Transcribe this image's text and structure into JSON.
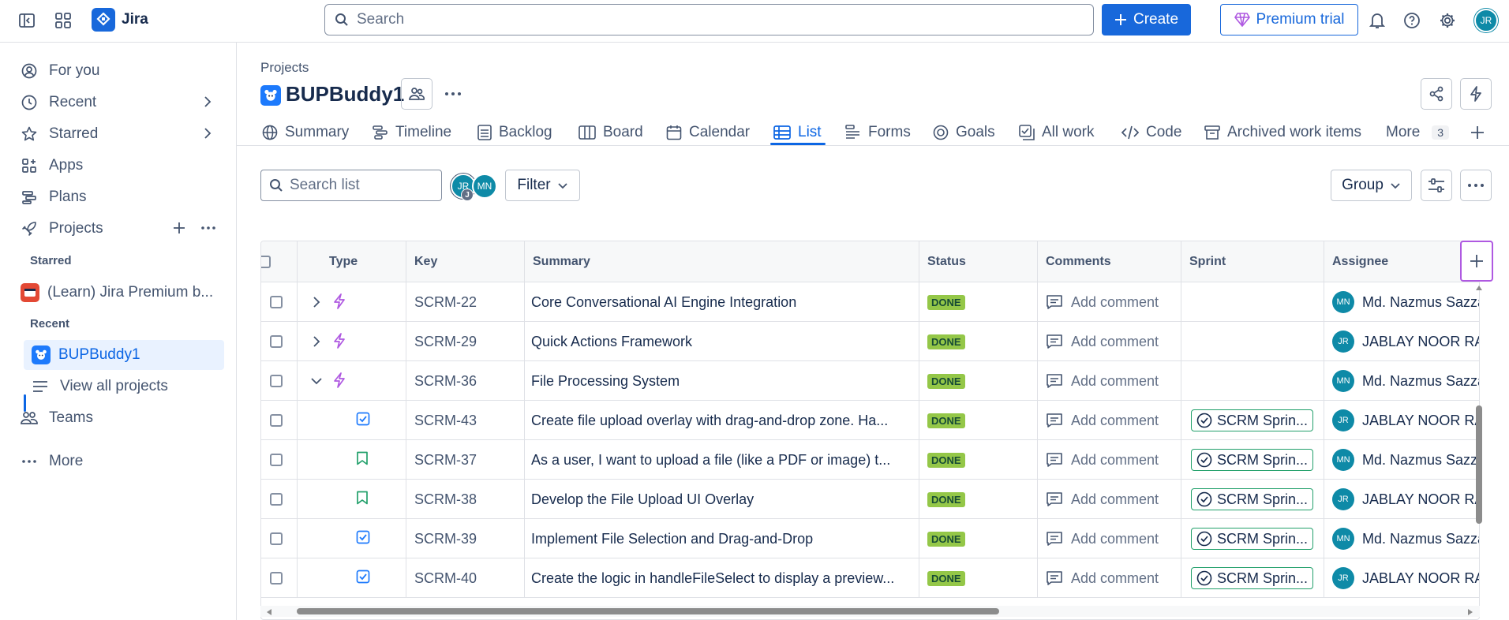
{
  "topbar": {
    "app_name": "Jira",
    "search_placeholder": "Search",
    "create_label": "Create",
    "premium_label": "Premium trial",
    "user_initials": "JR"
  },
  "sidebar": {
    "items": [
      {
        "label": "For you",
        "icon": "user-circle-icon"
      },
      {
        "label": "Recent",
        "icon": "clock-icon"
      },
      {
        "label": "Starred",
        "icon": "star-icon"
      },
      {
        "label": "Apps",
        "icon": "apps-icon"
      },
      {
        "label": "Plans",
        "icon": "plans-icon"
      },
      {
        "label": "Projects",
        "icon": "rocket-icon"
      }
    ],
    "starred_heading": "Starred",
    "starred_project": "(Learn) Jira Premium b...",
    "recent_heading": "Recent",
    "recent_project": "BUPBuddy1",
    "view_all": "View all projects",
    "teams": "Teams",
    "more": "More"
  },
  "header": {
    "breadcrumb": "Projects",
    "project_title": "BUPBuddy1"
  },
  "tabs": [
    {
      "label": "Summary",
      "icon": "globe-icon"
    },
    {
      "label": "Timeline",
      "icon": "timeline-icon"
    },
    {
      "label": "Backlog",
      "icon": "backlog-icon"
    },
    {
      "label": "Board",
      "icon": "board-icon"
    },
    {
      "label": "Calendar",
      "icon": "calendar-icon"
    },
    {
      "label": "List",
      "icon": "list-icon",
      "active": true
    },
    {
      "label": "Forms",
      "icon": "forms-icon"
    },
    {
      "label": "Goals",
      "icon": "goals-icon"
    },
    {
      "label": "All work",
      "icon": "all-work-icon"
    },
    {
      "label": "Code",
      "icon": "code-icon"
    },
    {
      "label": "Archived work items",
      "icon": "archive-icon"
    }
  ],
  "tabs_more": {
    "label": "More",
    "count": "3"
  },
  "toolbar": {
    "search_placeholder": "Search list",
    "avatars": [
      "JR",
      "MN"
    ],
    "avatar_badge": "J",
    "filter_label": "Filter",
    "group_label": "Group"
  },
  "table": {
    "columns": [
      "Type",
      "Key",
      "Summary",
      "Status",
      "Comments",
      "Sprint",
      "Assignee"
    ],
    "rows": [
      {
        "expand": "right",
        "type": "epic",
        "key": "SCRM-22",
        "summary": "Core Conversational AI Engine Integration",
        "status": "DONE",
        "comment": "Add comment",
        "sprint": "",
        "assignee_initials": "MN",
        "assignee": "Md. Nazmus Sazzad"
      },
      {
        "expand": "right",
        "type": "epic",
        "key": "SCRM-29",
        "summary": "Quick Actions Framework",
        "status": "DONE",
        "comment": "Add comment",
        "sprint": "",
        "assignee_initials": "JR",
        "assignee": "JABLAY NOOR RAHMAN"
      },
      {
        "expand": "down",
        "type": "epic",
        "key": "SCRM-36",
        "summary": "File Processing System",
        "status": "DONE",
        "comment": "Add comment",
        "sprint": "",
        "assignee_initials": "MN",
        "assignee": "Md. Nazmus Sazzad"
      },
      {
        "expand": "",
        "type": "task",
        "key": "SCRM-43",
        "summary": "Create file upload overlay with drag-and-drop zone. Ha...",
        "status": "DONE",
        "comment": "Add comment",
        "sprint": "SCRM Sprin...",
        "assignee_initials": "JR",
        "assignee": "JABLAY NOOR RAHMAN"
      },
      {
        "expand": "",
        "type": "story",
        "key": "SCRM-37",
        "summary": "As a user, I want to upload a file (like a PDF or image) t...",
        "status": "DONE",
        "comment": "Add comment",
        "sprint": "SCRM Sprin...",
        "assignee_initials": "MN",
        "assignee": "Md. Nazmus Sazzad"
      },
      {
        "expand": "",
        "type": "story",
        "key": "SCRM-38",
        "summary": "Develop the File Upload UI Overlay",
        "status": "DONE",
        "comment": "Add comment",
        "sprint": "SCRM Sprin...",
        "assignee_initials": "JR",
        "assignee": "JABLAY NOOR RAHMAN"
      },
      {
        "expand": "",
        "type": "task",
        "key": "SCRM-39",
        "summary": "Implement File Selection and Drag-and-Drop",
        "status": "DONE",
        "comment": "Add comment",
        "sprint": "SCRM Sprin...",
        "assignee_initials": "MN",
        "assignee": "Md. Nazmus Sazzad"
      },
      {
        "expand": "",
        "type": "task",
        "key": "SCRM-40",
        "summary": "Create the logic in handleFileSelect to display a preview...",
        "status": "DONE",
        "comment": "Add comment",
        "sprint": "SCRM Sprin...",
        "assignee_initials": "JR",
        "assignee": "JABLAY NOOR RAHMAN"
      }
    ]
  },
  "colors": {
    "accent": "#0c66e4",
    "jr_avatar": "#0e8aa7",
    "mn_avatar": "#0e8aa7",
    "status_done": "#94c748",
    "epic": "#af59e1",
    "story": "#22a06b",
    "task": "#1d7afc"
  }
}
